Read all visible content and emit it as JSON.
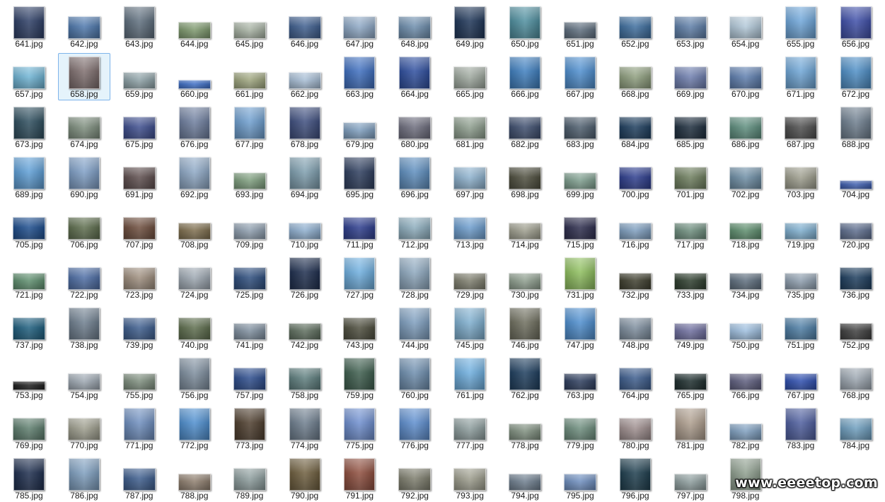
{
  "files": [
    {
      "name": "641.jpg",
      "shape": "portrait",
      "tint": "#2e3f66"
    },
    {
      "name": "642.jpg",
      "shape": "landscape",
      "tint": "#4f79ad"
    },
    {
      "name": "643.jpg",
      "shape": "portrait",
      "tint": "#5f6f7e"
    },
    {
      "name": "644.jpg",
      "shape": "wide",
      "tint": "#7f9a6f"
    },
    {
      "name": "645.jpg",
      "shape": "wide",
      "tint": "#a8b3a4"
    },
    {
      "name": "646.jpg",
      "shape": "landscape",
      "tint": "#3f5f8f"
    },
    {
      "name": "647.jpg",
      "shape": "landscape",
      "tint": "#8fa9c6"
    },
    {
      "name": "648.jpg",
      "shape": "landscape",
      "tint": "#6f8fae"
    },
    {
      "name": "649.jpg",
      "shape": "portrait",
      "tint": "#1f3658"
    },
    {
      "name": "650.jpg",
      "shape": "portrait",
      "tint": "#4f8f9f"
    },
    {
      "name": "651.jpg",
      "shape": "wide",
      "tint": "#5f6f7f"
    },
    {
      "name": "652.jpg",
      "shape": "landscape",
      "tint": "#3f6f9f"
    },
    {
      "name": "653.jpg",
      "shape": "landscape",
      "tint": "#5f7fa8"
    },
    {
      "name": "654.jpg",
      "shape": "landscape",
      "tint": "#b3c9d9"
    },
    {
      "name": "655.jpg",
      "shape": "portrait",
      "tint": "#6fa6d9"
    },
    {
      "name": "656.jpg",
      "shape": "portrait",
      "tint": "#3f4fa8"
    },
    {
      "name": "657.jpg",
      "shape": "landscape",
      "tint": "#6fb4d4"
    },
    {
      "name": "658.jpg",
      "shape": "portrait",
      "tint": "#7f6f6f"
    },
    {
      "name": "659.jpg",
      "shape": "wide",
      "tint": "#8fa3a8"
    },
    {
      "name": "660.jpg",
      "shape": "thin",
      "tint": "#3f6fc6"
    },
    {
      "name": "661.jpg",
      "shape": "wide",
      "tint": "#9fa67f"
    },
    {
      "name": "662.jpg",
      "shape": "wide",
      "tint": "#a9bfd6"
    },
    {
      "name": "663.jpg",
      "shape": "portrait",
      "tint": "#3f6fbf"
    },
    {
      "name": "664.jpg",
      "shape": "portrait",
      "tint": "#2f4f9f"
    },
    {
      "name": "665.jpg",
      "shape": "landscape",
      "tint": "#9fa99f"
    },
    {
      "name": "666.jpg",
      "shape": "portrait",
      "tint": "#3f7fbf"
    },
    {
      "name": "667.jpg",
      "shape": "portrait",
      "tint": "#4f8fcf"
    },
    {
      "name": "668.jpg",
      "shape": "landscape",
      "tint": "#8f9f7f"
    },
    {
      "name": "669.jpg",
      "shape": "landscape",
      "tint": "#6f7faf"
    },
    {
      "name": "670.jpg",
      "shape": "landscape",
      "tint": "#5f7faf"
    },
    {
      "name": "671.jpg",
      "shape": "portrait",
      "tint": "#6fa6d6"
    },
    {
      "name": "672.jpg",
      "shape": "portrait",
      "tint": "#4f8fc6"
    },
    {
      "name": "673.jpg",
      "shape": "portrait",
      "tint": "#2f4f5f"
    },
    {
      "name": "674.jpg",
      "shape": "landscape",
      "tint": "#7f8f7f"
    },
    {
      "name": "675.jpg",
      "shape": "landscape",
      "tint": "#3f4f8f"
    },
    {
      "name": "676.jpg",
      "shape": "portrait",
      "tint": "#6f7f9f"
    },
    {
      "name": "677.jpg",
      "shape": "portrait",
      "tint": "#6f9fcf"
    },
    {
      "name": "678.jpg",
      "shape": "portrait",
      "tint": "#3f4f7f"
    },
    {
      "name": "679.jpg",
      "shape": "wide",
      "tint": "#7f9fbf"
    },
    {
      "name": "680.jpg",
      "shape": "landscape",
      "tint": "#6f6f7f"
    },
    {
      "name": "681.jpg",
      "shape": "landscape",
      "tint": "#8f9f8f"
    },
    {
      "name": "682.jpg",
      "shape": "landscape",
      "tint": "#3f4f6f"
    },
    {
      "name": "683.jpg",
      "shape": "landscape",
      "tint": "#4f5f6f"
    },
    {
      "name": "684.jpg",
      "shape": "landscape",
      "tint": "#1f3f5f"
    },
    {
      "name": "685.jpg",
      "shape": "landscape",
      "tint": "#1f2f3f"
    },
    {
      "name": "686.jpg",
      "shape": "landscape",
      "tint": "#5f8f7f"
    },
    {
      "name": "687.jpg",
      "shape": "landscape",
      "tint": "#4f4f4f"
    },
    {
      "name": "688.jpg",
      "shape": "portrait",
      "tint": "#6f7f8f"
    },
    {
      "name": "689.jpg",
      "shape": "portrait",
      "tint": "#5f9fd6"
    },
    {
      "name": "690.jpg",
      "shape": "portrait",
      "tint": "#7f9fc6"
    },
    {
      "name": "691.jpg",
      "shape": "landscape",
      "tint": "#5f4f4f"
    },
    {
      "name": "692.jpg",
      "shape": "portrait",
      "tint": "#8fa9c6"
    },
    {
      "name": "693.jpg",
      "shape": "wide",
      "tint": "#7f9f7f"
    },
    {
      "name": "694.jpg",
      "shape": "portrait",
      "tint": "#7f9faf"
    },
    {
      "name": "695.jpg",
      "shape": "portrait",
      "tint": "#2f3f5f"
    },
    {
      "name": "696.jpg",
      "shape": "portrait",
      "tint": "#5f8fbf"
    },
    {
      "name": "697.jpg",
      "shape": "landscape",
      "tint": "#8fb3cf"
    },
    {
      "name": "698.jpg",
      "shape": "landscape",
      "tint": "#4f4f3f"
    },
    {
      "name": "699.jpg",
      "shape": "wide",
      "tint": "#7f9f8f"
    },
    {
      "name": "700.jpg",
      "shape": "landscape",
      "tint": "#2f3f8f"
    },
    {
      "name": "701.jpg",
      "shape": "landscape",
      "tint": "#6f7f5f"
    },
    {
      "name": "702.jpg",
      "shape": "landscape",
      "tint": "#6f8fa6"
    },
    {
      "name": "703.jpg",
      "shape": "landscape",
      "tint": "#9f9f8f"
    },
    {
      "name": "704.jpg",
      "shape": "thin",
      "tint": "#3f5faf"
    },
    {
      "name": "705.jpg",
      "shape": "landscape",
      "tint": "#1f4f8f"
    },
    {
      "name": "706.jpg",
      "shape": "landscape",
      "tint": "#5f6f4f"
    },
    {
      "name": "707.jpg",
      "shape": "landscape",
      "tint": "#6f4f3f"
    },
    {
      "name": "708.jpg",
      "shape": "wide",
      "tint": "#7f6f4f"
    },
    {
      "name": "709.jpg",
      "shape": "wide",
      "tint": "#8f9faf"
    },
    {
      "name": "710.jpg",
      "shape": "wide",
      "tint": "#8fafcf"
    },
    {
      "name": "711.jpg",
      "shape": "landscape",
      "tint": "#2f3f8f"
    },
    {
      "name": "712.jpg",
      "shape": "landscape",
      "tint": "#8fafbf"
    },
    {
      "name": "713.jpg",
      "shape": "landscape",
      "tint": "#6f9fcf"
    },
    {
      "name": "714.jpg",
      "shape": "wide",
      "tint": "#9f9f8f"
    },
    {
      "name": "715.jpg",
      "shape": "landscape",
      "tint": "#2f2f4f"
    },
    {
      "name": "716.jpg",
      "shape": "wide",
      "tint": "#7f9fbf"
    },
    {
      "name": "717.jpg",
      "shape": "wide",
      "tint": "#6f8f7f"
    },
    {
      "name": "718.jpg",
      "shape": "wide",
      "tint": "#5f8f6f"
    },
    {
      "name": "719.jpg",
      "shape": "wide",
      "tint": "#7fafcf"
    },
    {
      "name": "720.jpg",
      "shape": "wide",
      "tint": "#5f6f8f"
    },
    {
      "name": "721.jpg",
      "shape": "wide",
      "tint": "#5f8f6f"
    },
    {
      "name": "722.jpg",
      "shape": "landscape",
      "tint": "#4f6fa6"
    },
    {
      "name": "723.jpg",
      "shape": "landscape",
      "tint": "#9f8f7f"
    },
    {
      "name": "724.jpg",
      "shape": "landscape",
      "tint": "#9fa9b3"
    },
    {
      "name": "725.jpg",
      "shape": "landscape",
      "tint": "#2f4f7f"
    },
    {
      "name": "726.jpg",
      "shape": "portrait",
      "tint": "#1f2f4f"
    },
    {
      "name": "727.jpg",
      "shape": "portrait",
      "tint": "#6fafdf"
    },
    {
      "name": "728.jpg",
      "shape": "portrait",
      "tint": "#8fa9bf"
    },
    {
      "name": "729.jpg",
      "shape": "wide",
      "tint": "#7f7f6f"
    },
    {
      "name": "730.jpg",
      "shape": "wide",
      "tint": "#8f9f8f"
    },
    {
      "name": "731.jpg",
      "shape": "portrait",
      "tint": "#8fbf5f"
    },
    {
      "name": "732.jpg",
      "shape": "wide",
      "tint": "#3f3f2f"
    },
    {
      "name": "733.jpg",
      "shape": "wide",
      "tint": "#2f3f2f"
    },
    {
      "name": "734.jpg",
      "shape": "wide",
      "tint": "#5f6f7f"
    },
    {
      "name": "735.jpg",
      "shape": "wide",
      "tint": "#8f9faf"
    },
    {
      "name": "736.jpg",
      "shape": "landscape",
      "tint": "#1f3f5f"
    },
    {
      "name": "737.jpg",
      "shape": "landscape",
      "tint": "#1f5f7f"
    },
    {
      "name": "738.jpg",
      "shape": "portrait",
      "tint": "#6f7f8f"
    },
    {
      "name": "739.jpg",
      "shape": "landscape",
      "tint": "#3f5f8f"
    },
    {
      "name": "740.jpg",
      "shape": "landscape",
      "tint": "#5f6f4f"
    },
    {
      "name": "741.jpg",
      "shape": "wide",
      "tint": "#7f8f9f"
    },
    {
      "name": "742.jpg",
      "shape": "wide",
      "tint": "#5f6f5f"
    },
    {
      "name": "743.jpg",
      "shape": "landscape",
      "tint": "#4f4f3f"
    },
    {
      "name": "744.jpg",
      "shape": "portrait",
      "tint": "#7f9fbf"
    },
    {
      "name": "745.jpg",
      "shape": "portrait",
      "tint": "#7fafcf"
    },
    {
      "name": "746.jpg",
      "shape": "portrait",
      "tint": "#6f6f5f"
    },
    {
      "name": "747.jpg",
      "shape": "portrait",
      "tint": "#4f8fcf"
    },
    {
      "name": "748.jpg",
      "shape": "landscape",
      "tint": "#7f8f9f"
    },
    {
      "name": "749.jpg",
      "shape": "wide",
      "tint": "#6f6f9f"
    },
    {
      "name": "750.jpg",
      "shape": "wide",
      "tint": "#9fbfdf"
    },
    {
      "name": "751.jpg",
      "shape": "landscape",
      "tint": "#4f7fa6"
    },
    {
      "name": "752.jpg",
      "shape": "wide",
      "tint": "#3f3f3f"
    },
    {
      "name": "753.jpg",
      "shape": "thin",
      "tint": "#1f1f1f"
    },
    {
      "name": "754.jpg",
      "shape": "wide",
      "tint": "#9fa9b3"
    },
    {
      "name": "755.jpg",
      "shape": "wide",
      "tint": "#7f8f7f"
    },
    {
      "name": "756.jpg",
      "shape": "portrait",
      "tint": "#7f8f9f"
    },
    {
      "name": "757.jpg",
      "shape": "landscape",
      "tint": "#2f4f8f"
    },
    {
      "name": "758.jpg",
      "shape": "landscape",
      "tint": "#5f7f7f"
    },
    {
      "name": "759.jpg",
      "shape": "portrait",
      "tint": "#3f5f4f"
    },
    {
      "name": "760.jpg",
      "shape": "portrait",
      "tint": "#6f8faf"
    },
    {
      "name": "761.jpg",
      "shape": "portrait",
      "tint": "#6fafdf"
    },
    {
      "name": "762.jpg",
      "shape": "portrait",
      "tint": "#1f3f5f"
    },
    {
      "name": "763.jpg",
      "shape": "wide",
      "tint": "#2f3f5f"
    },
    {
      "name": "764.jpg",
      "shape": "landscape",
      "tint": "#3f5f8f"
    },
    {
      "name": "765.jpg",
      "shape": "wide",
      "tint": "#1f2f2f"
    },
    {
      "name": "766.jpg",
      "shape": "wide",
      "tint": "#5f5f7f"
    },
    {
      "name": "767.jpg",
      "shape": "wide",
      "tint": "#2f4faf"
    },
    {
      "name": "768.jpg",
      "shape": "landscape",
      "tint": "#9fa9b3"
    },
    {
      "name": "769.jpg",
      "shape": "landscape",
      "tint": "#5f7f6f"
    },
    {
      "name": "770.jpg",
      "shape": "landscape",
      "tint": "#9f9f8f"
    },
    {
      "name": "771.jpg",
      "shape": "portrait",
      "tint": "#6f8fbf"
    },
    {
      "name": "772.jpg",
      "shape": "portrait",
      "tint": "#4f8fcf"
    },
    {
      "name": "773.jpg",
      "shape": "portrait",
      "tint": "#4f3f2f"
    },
    {
      "name": "774.jpg",
      "shape": "portrait",
      "tint": "#6f7f8f"
    },
    {
      "name": "775.jpg",
      "shape": "portrait",
      "tint": "#6f8fcf"
    },
    {
      "name": "776.jpg",
      "shape": "portrait",
      "tint": "#5f8fcf"
    },
    {
      "name": "777.jpg",
      "shape": "landscape",
      "tint": "#8f9f9f"
    },
    {
      "name": "778.jpg",
      "shape": "wide",
      "tint": "#7f8f7f"
    },
    {
      "name": "779.jpg",
      "shape": "landscape",
      "tint": "#6f8f7f"
    },
    {
      "name": "780.jpg",
      "shape": "landscape",
      "tint": "#9f8f8f"
    },
    {
      "name": "781.jpg",
      "shape": "portrait",
      "tint": "#af9f8f"
    },
    {
      "name": "782.jpg",
      "shape": "wide",
      "tint": "#7f9fbf"
    },
    {
      "name": "783.jpg",
      "shape": "portrait",
      "tint": "#4f5f9f"
    },
    {
      "name": "784.jpg",
      "shape": "landscape",
      "tint": "#6f9fbf"
    },
    {
      "name": "785.jpg",
      "shape": "portrait",
      "tint": "#1f2f4f"
    },
    {
      "name": "786.jpg",
      "shape": "portrait",
      "tint": "#7f9fbf"
    },
    {
      "name": "787.jpg",
      "shape": "landscape",
      "tint": "#3f5f8f"
    },
    {
      "name": "788.jpg",
      "shape": "wide",
      "tint": "#8f7f6f"
    },
    {
      "name": "789.jpg",
      "shape": "landscape",
      "tint": "#8f9f9f"
    },
    {
      "name": "790.jpg",
      "shape": "portrait",
      "tint": "#6f5f3f"
    },
    {
      "name": "791.jpg",
      "shape": "portrait",
      "tint": "#8f4f3f"
    },
    {
      "name": "792.jpg",
      "shape": "landscape",
      "tint": "#7f7f6f"
    },
    {
      "name": "793.jpg",
      "shape": "landscape",
      "tint": "#9f9f8f"
    },
    {
      "name": "794.jpg",
      "shape": "wide",
      "tint": "#6f7f8f"
    },
    {
      "name": "795.jpg",
      "shape": "wide",
      "tint": "#6f8fbf"
    },
    {
      "name": "796.jpg",
      "shape": "portrait",
      "tint": "#1f3f4f"
    },
    {
      "name": "797.jpg",
      "shape": "wide",
      "tint": "#8f9f9f"
    },
    {
      "name": "798.jpg",
      "shape": "portrait",
      "tint": "#8f9f8f"
    }
  ],
  "selected_file": "658.jpg",
  "watermark": "www.eeeetop.com"
}
